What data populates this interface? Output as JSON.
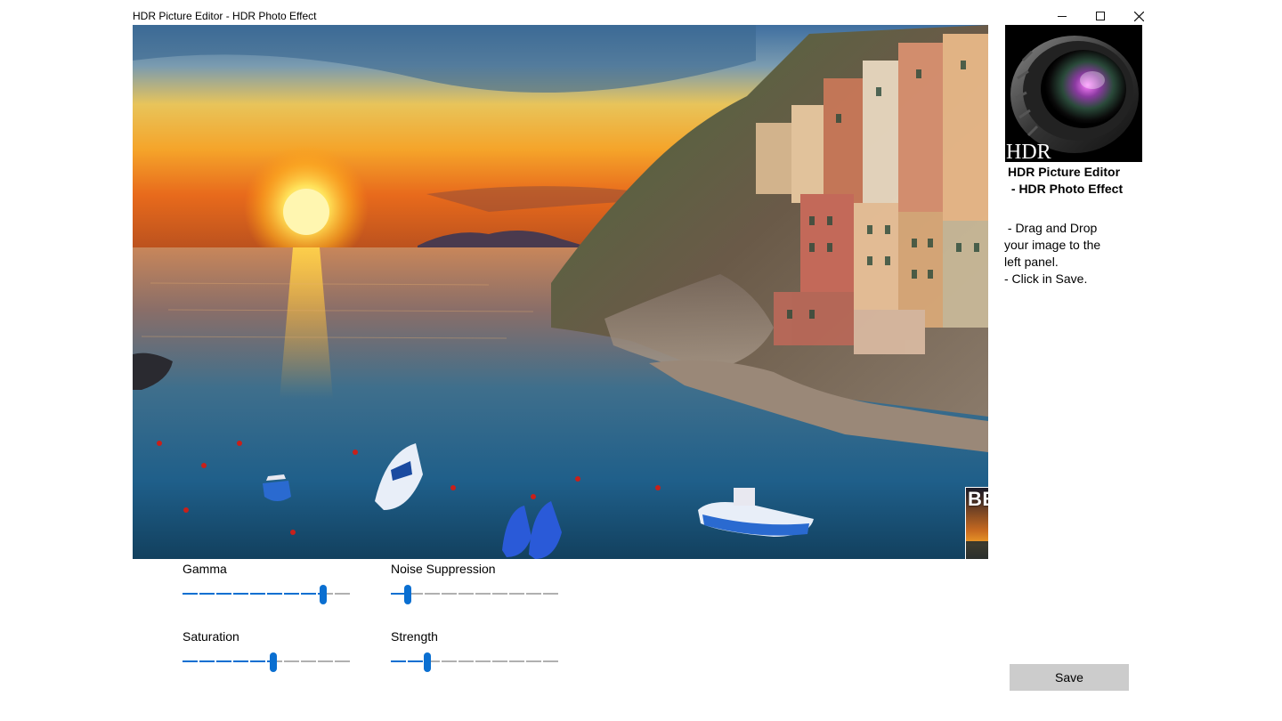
{
  "window": {
    "title": "HDR Picture Editor - HDR Photo Effect"
  },
  "icons": {
    "minimize": "minimize-icon",
    "maximize": "maximize-icon",
    "close": "close-icon"
  },
  "preview": {
    "before_label": "BEFORE"
  },
  "sidebar": {
    "logo_text": "HDR",
    "app_name_line1": "HDR Picture Editor",
    "app_name_line2": " - HDR Photo Effect",
    "instructions": [
      " - Drag and Drop",
      "your image to the",
      "left panel.",
      "- Click in Save."
    ],
    "save_label": "Save"
  },
  "sliders": {
    "gamma": {
      "label": "Gamma",
      "value_fraction": 0.84
    },
    "noise_suppression": {
      "label": "Noise Suppression",
      "value_fraction": 0.1
    },
    "saturation": {
      "label": "Saturation",
      "value_fraction": 0.54
    },
    "strength": {
      "label": "Strength",
      "value_fraction": 0.22
    }
  },
  "colors": {
    "accent": "#0a6fd1",
    "save_button": "#cccccc"
  }
}
